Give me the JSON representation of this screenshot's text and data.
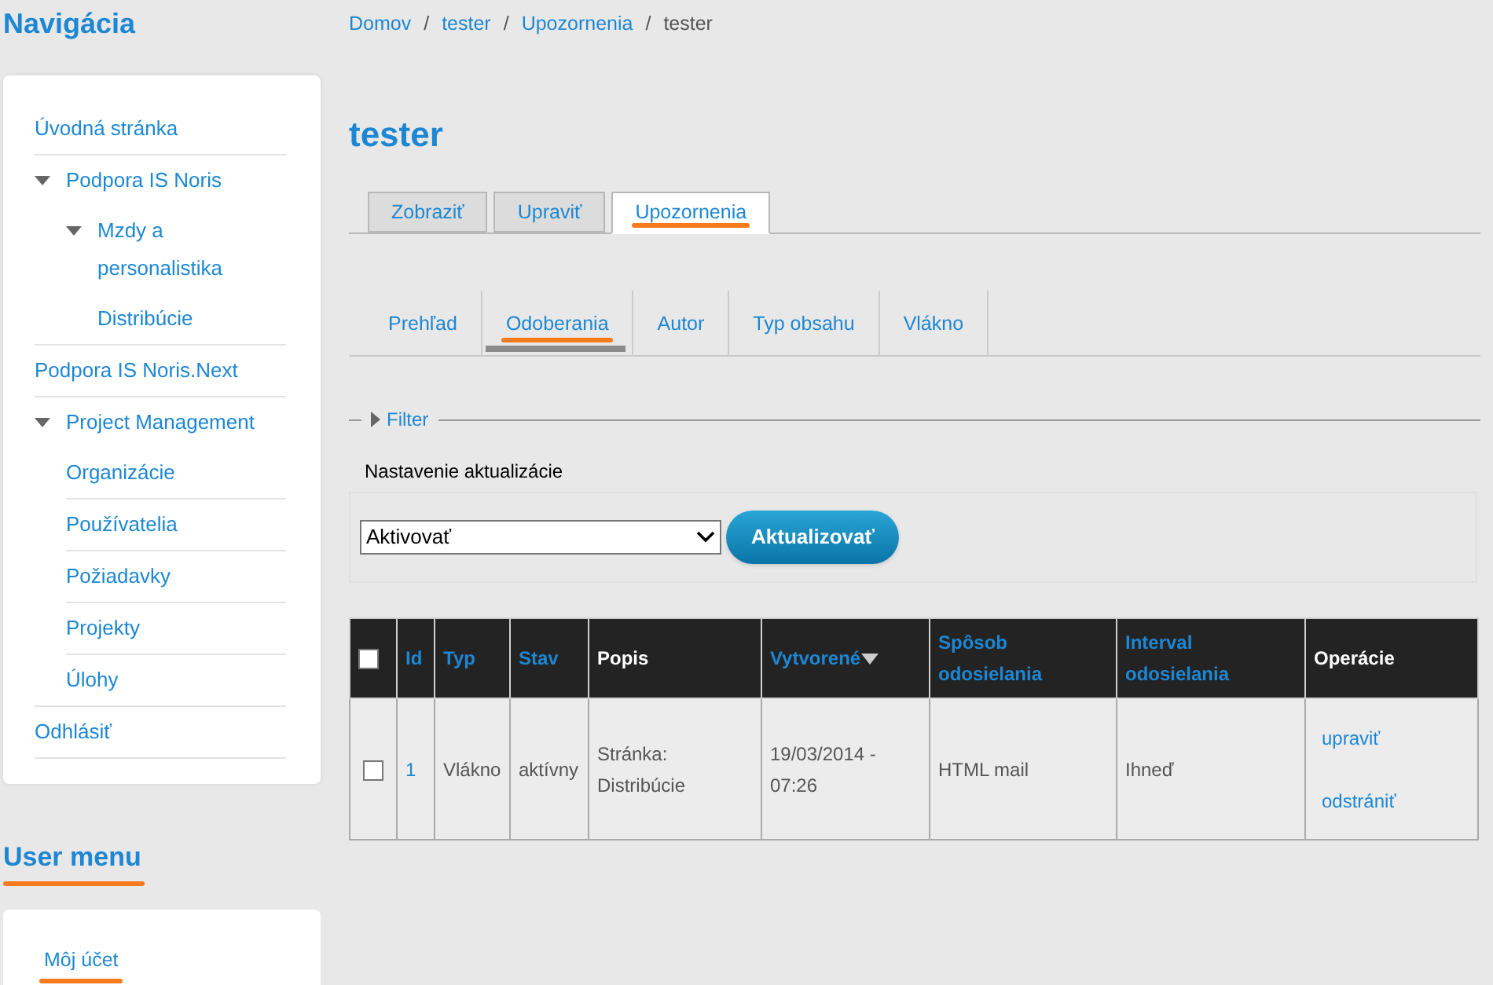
{
  "sidebar": {
    "title": "Navigácia",
    "items": [
      {
        "label": "Úvodná stránka"
      },
      {
        "label": "Podpora IS Noris",
        "expanded": true,
        "children": [
          {
            "label": "Mzdy a personalistika",
            "expanded": true,
            "children": [
              {
                "label": "Distribúcie"
              }
            ]
          }
        ]
      },
      {
        "label": "Podpora IS Noris.Next"
      },
      {
        "label": "Project Management",
        "expanded": true,
        "children": [
          {
            "label": "Organizácie"
          },
          {
            "label": "Používatelia"
          },
          {
            "label": "Požiadavky"
          },
          {
            "label": "Projekty"
          },
          {
            "label": "Úlohy"
          }
        ]
      },
      {
        "label": "Odhlásiť"
      }
    ],
    "user_menu": {
      "title": "User menu",
      "underlined": true,
      "items": [
        {
          "label": "Môj účet",
          "underlined": true
        }
      ]
    }
  },
  "breadcrumb": [
    {
      "kind": "link",
      "label": "Domov"
    },
    {
      "kind": "separator",
      "label": "/"
    },
    {
      "kind": "link",
      "label": "tester"
    },
    {
      "kind": "separator",
      "label": "/"
    },
    {
      "kind": "link",
      "label": "Upozornenia"
    },
    {
      "kind": "separator",
      "label": "/"
    },
    {
      "kind": "current",
      "label": "tester"
    }
  ],
  "page_title": "tester",
  "tabs": [
    {
      "label": "Zobraziť",
      "selected": false,
      "underlined": false
    },
    {
      "label": "Upraviť",
      "selected": false,
      "underlined": false
    },
    {
      "label": "Upozornenia",
      "selected": true,
      "underlined": true
    }
  ],
  "subtabs": [
    {
      "label": "Prehľad",
      "selected": false,
      "underlined": false
    },
    {
      "label": "Odoberania",
      "selected": true,
      "underlined": true
    },
    {
      "label": "Autor",
      "selected": false,
      "underlined": false
    },
    {
      "label": "Typ obsahu",
      "selected": false,
      "underlined": false
    },
    {
      "label": "Vlákno",
      "selected": false,
      "underlined": false
    }
  ],
  "filter": {
    "label": "Filter",
    "expanded": false
  },
  "update": {
    "legend": "Nastavenie aktualizácie",
    "select_value": "Aktivovať",
    "button": "Aktualizovať"
  },
  "table": {
    "columns": [
      {
        "kind": "checkbox",
        "checked": false
      },
      {
        "kind": "sortable",
        "label": "Id",
        "sorted": false
      },
      {
        "kind": "sortable",
        "label": "Typ",
        "sorted": false
      },
      {
        "kind": "sortable",
        "label": "Stav",
        "sorted": false
      },
      {
        "kind": "plain",
        "label": "Popis"
      },
      {
        "kind": "sortable",
        "label": "Vytvorené",
        "sorted": true
      },
      {
        "kind": "sortable",
        "label": "Spôsob odosielania",
        "sorted": false
      },
      {
        "kind": "sortable",
        "label": "Interval odosielania",
        "sorted": false
      },
      {
        "kind": "plain",
        "label": "Operácie"
      }
    ],
    "rows": [
      {
        "cells": [
          {
            "kind": "checkbox",
            "checked": false
          },
          {
            "kind": "link",
            "text": "1"
          },
          {
            "kind": "text",
            "text": "Vlákno"
          },
          {
            "kind": "text",
            "text": "aktívny"
          },
          {
            "kind": "text",
            "text": "Stránka: Distribúcie"
          },
          {
            "kind": "text",
            "text": "19/03/2014 - 07:26"
          },
          {
            "kind": "text",
            "text": "HTML mail"
          },
          {
            "kind": "text",
            "text": "Ihneď"
          },
          {
            "kind": "links",
            "links": [
              "upraviť",
              "odstrániť"
            ]
          }
        ]
      }
    ]
  }
}
